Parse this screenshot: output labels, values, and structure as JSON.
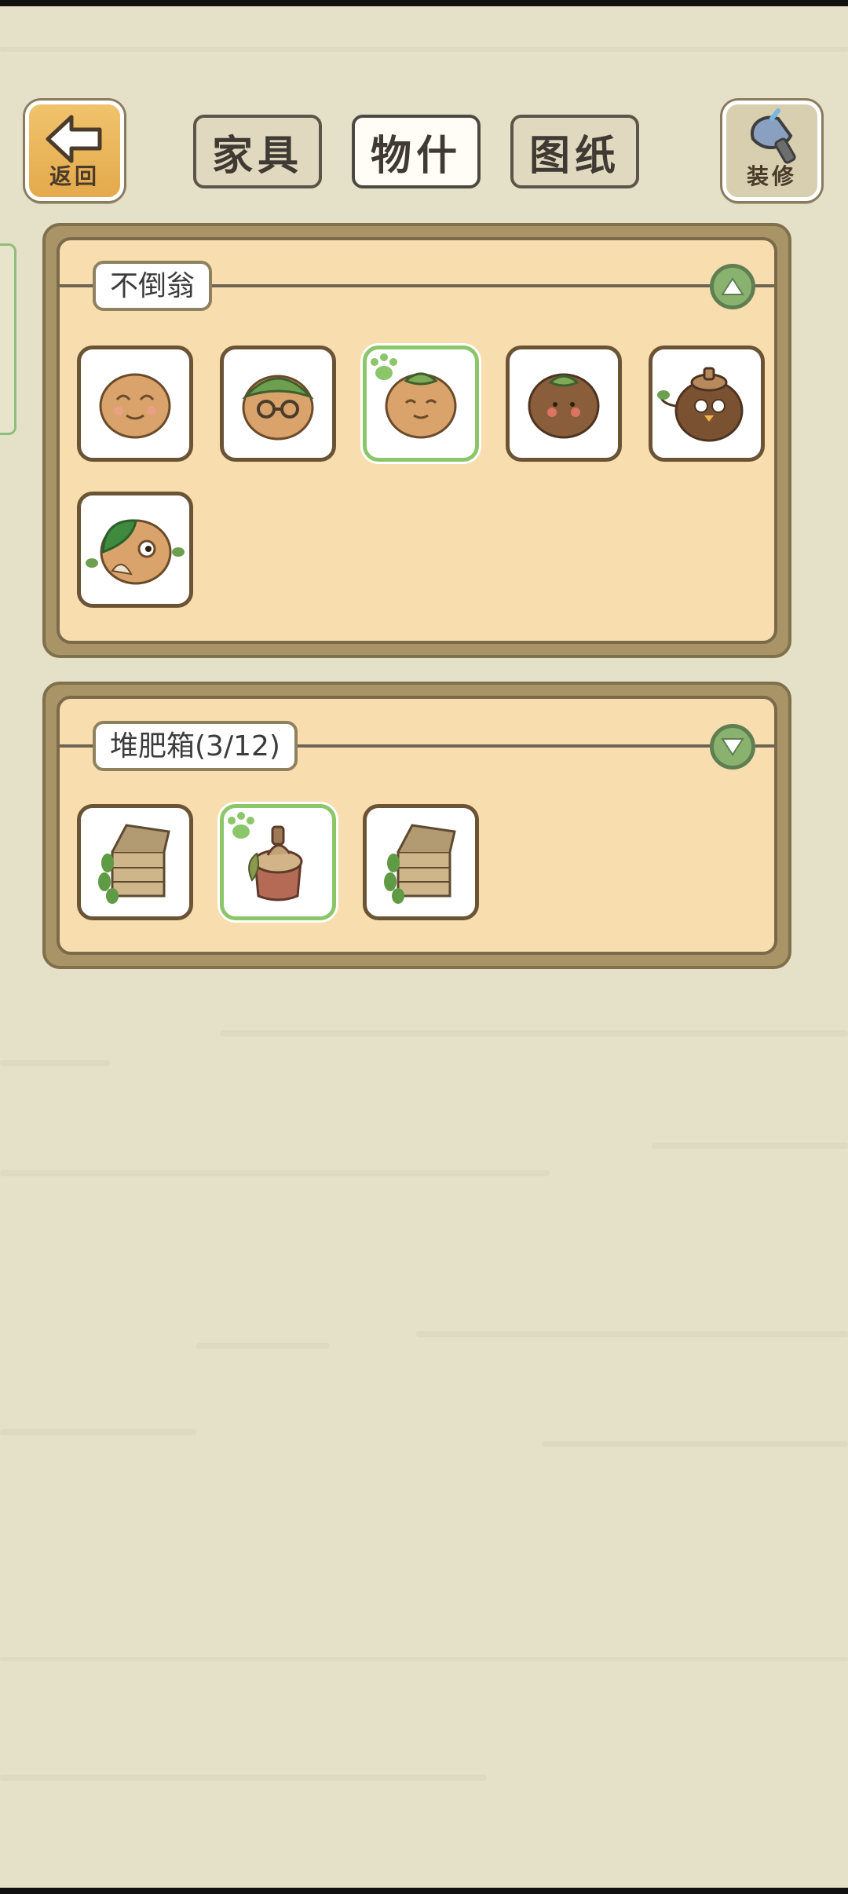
{
  "header": {
    "back_label": "返回",
    "decorate_label": "装修",
    "tabs": [
      {
        "label": "家具",
        "active": false
      },
      {
        "label": "物什",
        "active": true
      },
      {
        "label": "图纸",
        "active": false
      }
    ]
  },
  "sections": [
    {
      "title": "不倒翁",
      "expanded": true,
      "items": [
        {
          "icon": "tumbler-plain-icon",
          "selected": false
        },
        {
          "icon": "tumbler-leaf-glasses-icon",
          "selected": false
        },
        {
          "icon": "tumbler-sprout-icon",
          "selected": true
        },
        {
          "icon": "tumbler-dark-sprout-icon",
          "selected": false
        },
        {
          "icon": "tumbler-mushroom-hat-icon",
          "selected": false
        },
        {
          "icon": "tumbler-green-leaf-icon",
          "selected": false
        }
      ]
    },
    {
      "title": "堆肥箱(3/12)",
      "expanded": false,
      "items": [
        {
          "icon": "compost-crate-icon",
          "selected": false
        },
        {
          "icon": "compost-stump-icon",
          "selected": true
        },
        {
          "icon": "compost-crate-icon",
          "selected": false
        }
      ]
    }
  ],
  "colors": {
    "background": "#e5e1c9",
    "panel": "#f8deae",
    "selected_border": "#8cc66a",
    "toggle": "#8ab26f"
  }
}
